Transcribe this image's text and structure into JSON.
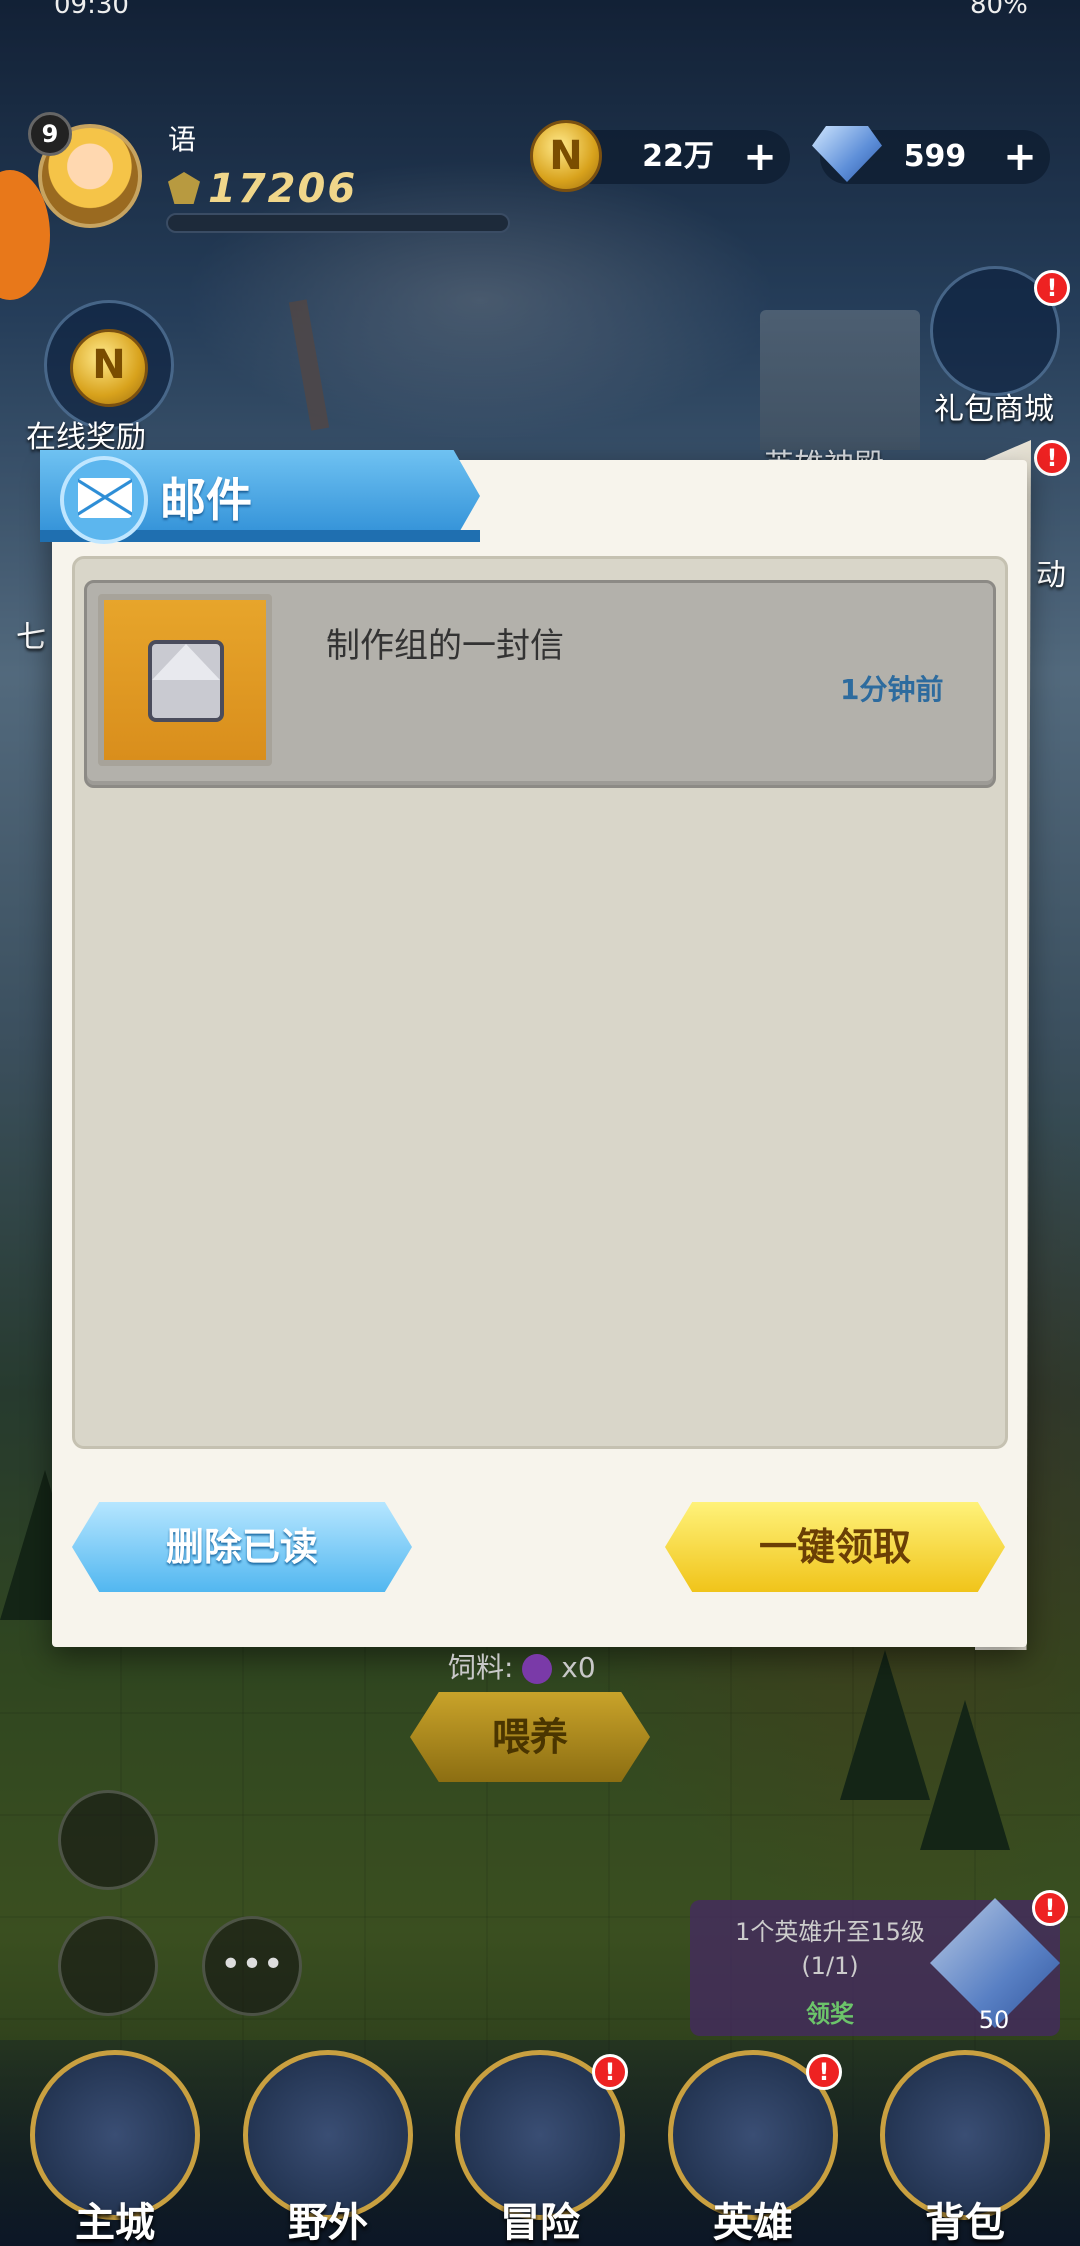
{
  "status_bar": {
    "time": "09:30",
    "battery": "80%"
  },
  "player": {
    "level": "9",
    "name": "语",
    "power": "17206"
  },
  "currencies": {
    "gold": "22万",
    "diamonds": "599",
    "add_symbol": "+"
  },
  "side_left": {
    "online_reward": "在线奖励",
    "seven_label": "七"
  },
  "side_right": {
    "gift_shop": "礼包商城",
    "hero_temple": "英雄神殿",
    "activity": "动"
  },
  "mail_dialog": {
    "title": "邮件",
    "items": [
      {
        "title": "制作组的一封信",
        "time": "1分钟前"
      }
    ],
    "delete_read_label": "删除已读",
    "claim_all_label": "一键领取"
  },
  "feed": {
    "label": "饲料:",
    "count": "x0",
    "button": "喂养"
  },
  "task": {
    "text": "1个英雄升至15级",
    "progress": "(1/1)",
    "claim": "领奖",
    "reward": "50"
  },
  "more_label": "•••",
  "alert_mark": "!",
  "nav": {
    "items": [
      "主城",
      "野外",
      "冒险",
      "英雄",
      "背包"
    ]
  }
}
